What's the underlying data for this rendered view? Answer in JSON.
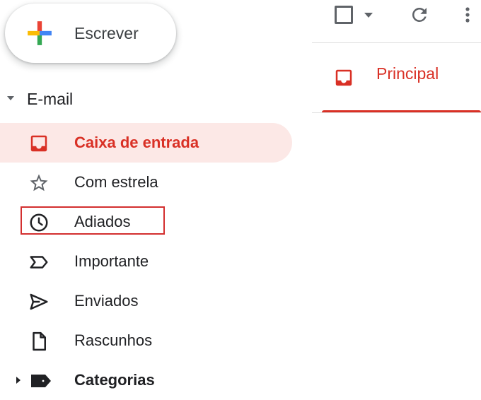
{
  "compose": {
    "label": "Escrever"
  },
  "mail_section": {
    "label": "E-mail"
  },
  "nav": {
    "items": [
      {
        "label": "Caixa de entrada"
      },
      {
        "label": "Com estrela"
      },
      {
        "label": "Adiados"
      },
      {
        "label": "Importante"
      },
      {
        "label": "Enviados"
      },
      {
        "label": "Rascunhos"
      },
      {
        "label": "Categorias"
      }
    ]
  },
  "tabs": [
    {
      "label": "Principal"
    }
  ],
  "colors": {
    "accent": "#d93025",
    "active_bg": "#fce8e6",
    "highlight_box": "#d32f2f",
    "icon_gray": "#5f6368"
  },
  "icons": {
    "compose": "multicolor-plus-icon",
    "section_caret": "caret-down-icon",
    "inbox": "inbox-icon",
    "starred": "star-icon",
    "snoozed": "clock-icon",
    "important": "important-label-icon",
    "sent": "send-icon",
    "drafts": "draft-file-icon",
    "categories": "label-icon",
    "categories_caret": "caret-right-icon",
    "select_all": "checkbox-icon",
    "select_menu": "caret-down-icon",
    "refresh": "refresh-icon",
    "more": "more-vertical-icon",
    "primary_tab": "inbox-icon"
  }
}
